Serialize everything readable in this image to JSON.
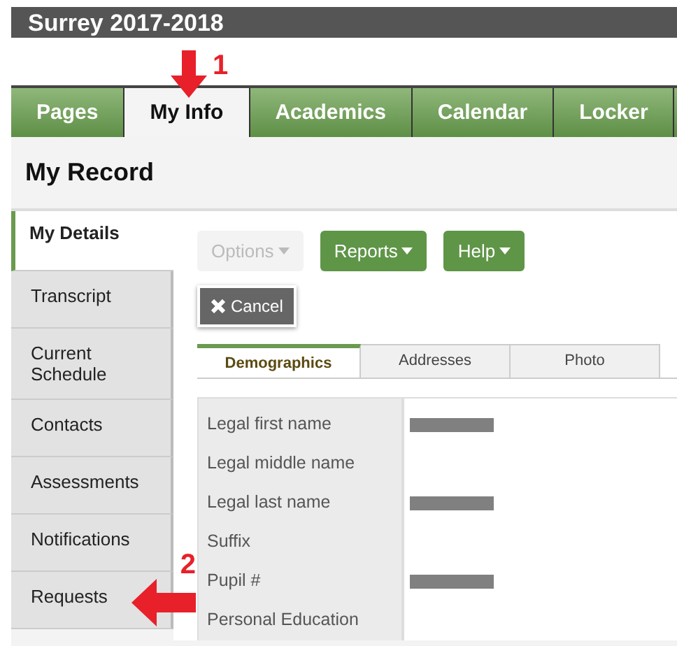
{
  "header": {
    "title": "Surrey 2017-2018"
  },
  "nav_tabs": [
    {
      "label": "Pages",
      "selected": false
    },
    {
      "label": "My Info",
      "selected": true
    },
    {
      "label": "Academics",
      "selected": false
    },
    {
      "label": "Calendar",
      "selected": false
    },
    {
      "label": "Locker",
      "selected": false
    }
  ],
  "page_title": "My Record",
  "sidebar": {
    "items": [
      {
        "label": "My Details",
        "selected": true
      },
      {
        "label": "Transcript",
        "selected": false
      },
      {
        "label": "Current Schedule",
        "selected": false
      },
      {
        "label": "Contacts",
        "selected": false
      },
      {
        "label": "Assessments",
        "selected": false
      },
      {
        "label": "Notifications",
        "selected": false
      },
      {
        "label": "Requests",
        "selected": false
      }
    ]
  },
  "toolbar": [
    {
      "label": "Options",
      "disabled": true
    },
    {
      "label": "Reports",
      "disabled": false
    },
    {
      "label": "Help",
      "disabled": false
    }
  ],
  "cancel_button": {
    "label": "Cancel"
  },
  "sub_tabs": [
    {
      "label": "Demographics",
      "selected": true
    },
    {
      "label": "Addresses",
      "selected": false
    },
    {
      "label": "Photo",
      "selected": false
    }
  ],
  "fields": [
    {
      "label": "Legal first name",
      "redacted": true
    },
    {
      "label": "Legal middle name",
      "redacted": false
    },
    {
      "label": "Legal last name",
      "redacted": true
    },
    {
      "label": "Suffix",
      "redacted": false
    },
    {
      "label": "Pupil #",
      "redacted": true
    },
    {
      "label": "Personal Education",
      "redacted": false
    }
  ],
  "annotations": [
    {
      "label": "1",
      "kind": "down"
    },
    {
      "label": "2",
      "kind": "left"
    }
  ]
}
